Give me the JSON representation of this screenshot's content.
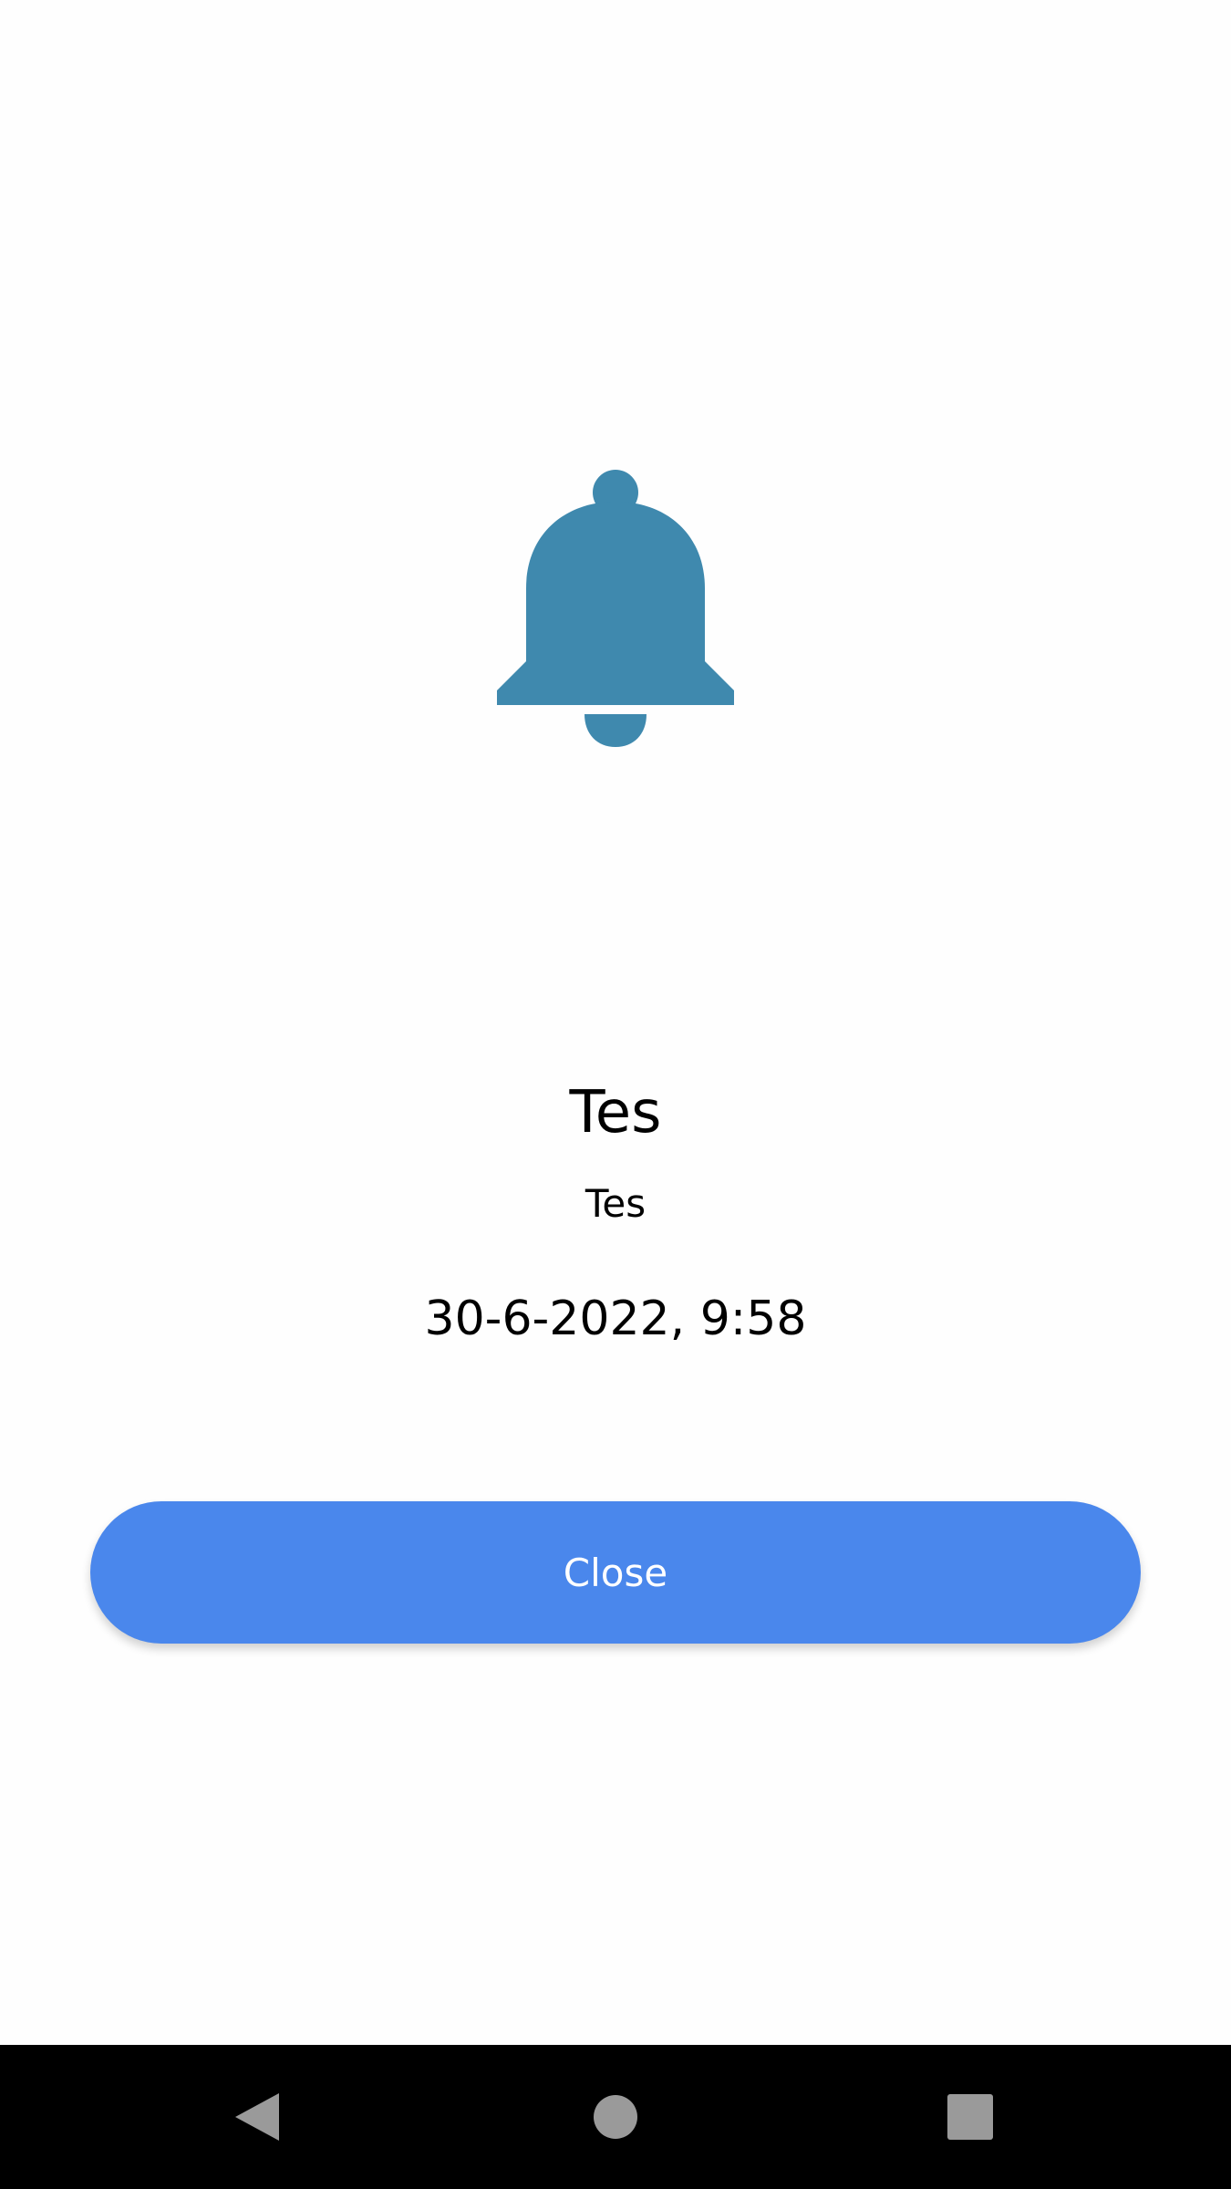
{
  "notification": {
    "icon": "bell-icon",
    "icon_color": "#3f89ae",
    "title": "Tes",
    "message": "Tes",
    "datetime": "30-6-2022, 9:58"
  },
  "actions": {
    "close_label": "Close",
    "close_color": "#4a87ec"
  },
  "navigation_bar": {
    "back_icon": "back-triangle-icon",
    "home_icon": "home-circle-icon",
    "recents_icon": "recents-square-icon",
    "icon_color": "#9a9a9a"
  }
}
